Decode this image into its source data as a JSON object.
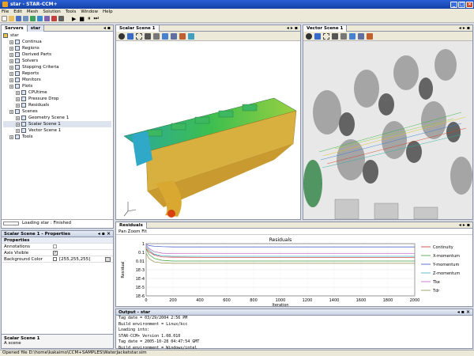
{
  "window": {
    "title": "star - STAR-CCM+"
  },
  "menu": [
    "File",
    "Edit",
    "Mesh",
    "Solution",
    "Tools",
    "Window",
    "Help"
  ],
  "servers_panel": {
    "tabs": [
      "Servers",
      "star"
    ],
    "tree": [
      {
        "label": "star",
        "level": 0
      },
      {
        "label": "Continua",
        "level": 1
      },
      {
        "label": "Regions",
        "level": 1
      },
      {
        "label": "Derived Parts",
        "level": 1
      },
      {
        "label": "Solvers",
        "level": 1
      },
      {
        "label": "Stopping Criteria",
        "level": 1
      },
      {
        "label": "Reports",
        "level": 1
      },
      {
        "label": "Monitors",
        "level": 1
      },
      {
        "label": "Plots",
        "level": 1
      },
      {
        "label": "CPUtime",
        "level": 2
      },
      {
        "label": "Pressure Drop",
        "level": 2
      },
      {
        "label": "Residuals",
        "level": 2
      },
      {
        "label": "Scenes",
        "level": 1
      },
      {
        "label": "Geometry Scene 1",
        "level": 2
      },
      {
        "label": "Scalar Scene 1",
        "level": 2
      },
      {
        "label": "Vector Scene 1",
        "level": 2
      },
      {
        "label": "Tools",
        "level": 1
      }
    ],
    "status": "Loading star : Finished"
  },
  "properties_panel": {
    "title": "Scalar Scene 1 - Properties",
    "section": "Properties",
    "rows": [
      {
        "key": "Annotations",
        "value": ""
      },
      {
        "key": "Axis Visible",
        "value": "✓"
      },
      {
        "key": "Background Color",
        "value": "[255,255,255]"
      }
    ],
    "footer_title": "Scalar Scene 1",
    "footer_desc": "A scene"
  },
  "scalar_scene": {
    "tab": "Scalar Scene 1"
  },
  "vector_scene": {
    "tab": "Vector Scene 1"
  },
  "residuals": {
    "tab": "Residuals",
    "menu": "Pan Zoom Fit",
    "chart_data": {
      "type": "line",
      "title": "Residuals",
      "xlabel": "Iteration",
      "ylabel": "Residual",
      "xlim": [
        0,
        2000
      ],
      "ylim_log": [
        -6,
        0
      ],
      "x_ticks": [
        "0",
        "200",
        "400",
        "600",
        "800",
        "1000",
        "1200",
        "1400",
        "1600",
        "1800",
        "2000"
      ],
      "y_ticks": [
        "1",
        "0.1",
        "0.01",
        "1E-3",
        "1E-4",
        "1E-5",
        "1E-6"
      ],
      "y_tick_exps": [
        0,
        -1,
        -2,
        -3,
        -4,
        -5,
        -6
      ],
      "legend_position": "right",
      "series": [
        {
          "name": "Continuity",
          "color": "#d03030",
          "x": [
            0,
            20,
            60,
            120,
            200,
            400,
            800,
            1200,
            1600,
            2000
          ],
          "y": [
            0.3,
            0.12,
            0.05,
            0.03,
            0.028,
            0.027,
            0.027,
            0.027,
            0.027,
            0.027
          ]
        },
        {
          "name": "X-momentum",
          "color": "#40a040",
          "x": [
            0,
            20,
            60,
            120,
            200,
            400,
            800,
            1200,
            1600,
            2000
          ],
          "y": [
            0.25,
            0.06,
            0.02,
            0.012,
            0.01,
            0.01,
            0.01,
            0.01,
            0.01,
            0.01
          ]
        },
        {
          "name": "Y-momentum",
          "color": "#3050c8",
          "x": [
            0,
            20,
            60,
            120,
            200,
            400,
            800,
            1200,
            1600,
            2000
          ],
          "y": [
            0.9,
            0.6,
            0.5,
            0.45,
            0.42,
            0.42,
            0.42,
            0.42,
            0.42,
            0.42
          ]
        },
        {
          "name": "Z-momentum",
          "color": "#40b0c0",
          "x": [
            0,
            20,
            60,
            120,
            200,
            400,
            800,
            1200,
            1600,
            2000
          ],
          "y": [
            0.5,
            0.2,
            0.06,
            0.04,
            0.035,
            0.035,
            0.035,
            0.035,
            0.035,
            0.035
          ]
        },
        {
          "name": "Tke",
          "color": "#c060c0",
          "x": [
            0,
            20,
            60,
            120,
            200,
            400,
            800,
            1200,
            1600,
            2000
          ],
          "y": [
            0.7,
            0.3,
            0.12,
            0.08,
            0.07,
            0.07,
            0.07,
            0.07,
            0.07,
            0.07
          ]
        },
        {
          "name": "Tdr",
          "color": "#909050",
          "x": [
            0,
            20,
            60,
            120,
            200,
            400,
            800,
            1200,
            1600,
            2000
          ],
          "y": [
            0.08,
            0.02,
            0.008,
            0.006,
            0.0055,
            0.0055,
            0.0055,
            0.0055,
            0.0055,
            0.0055
          ]
        }
      ]
    }
  },
  "output": {
    "title": "Output - star",
    "lines": [
      "Tag date = 03/29/2004 2:56 PM",
      "Build environment = Linux/kcc",
      "Loading into:",
      "  STAR-CCM+ Version 1.08.010",
      "  Tag date = 2005-10-28 04:47:54 GMT",
      "  Build environment = Windows/intel"
    ]
  },
  "statusbar": "Opened file D:\\home\\kakaimo\\CCM+SAMPLES\\WaterJacketstar.sim"
}
